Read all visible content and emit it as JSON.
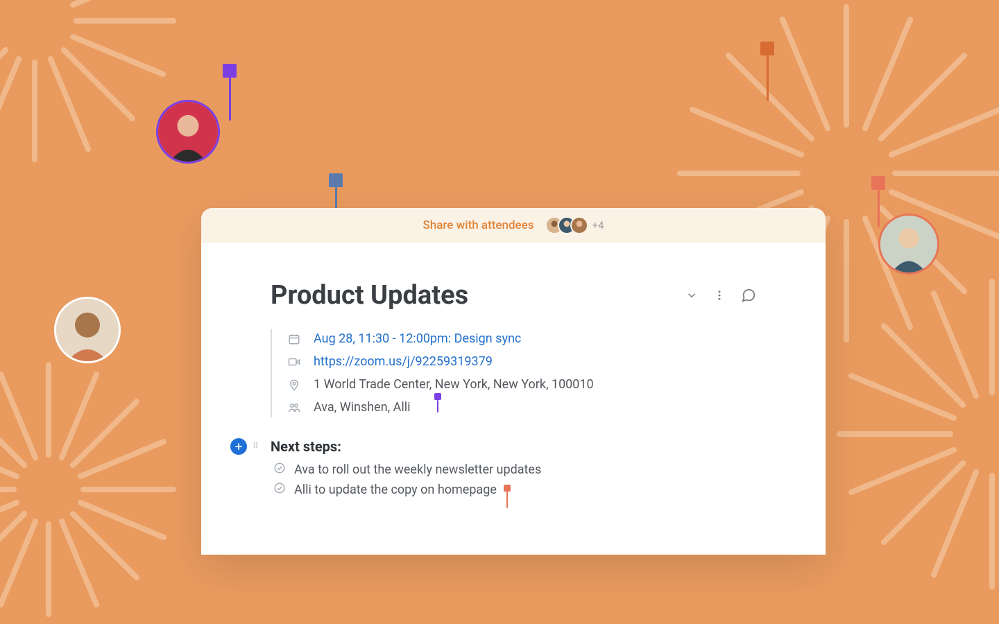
{
  "shareBar": {
    "label": "Share with attendees",
    "moreCount": "+4"
  },
  "doc": {
    "title": "Product Updates"
  },
  "meta": {
    "dateLine": "Aug 28, 11:30 - 12:00pm: Design sync",
    "link": "https://zoom.us/j/92259319379",
    "location": "1 World Trade Center, New York, New York, 100010",
    "people": "Ava, Winshen, Alli"
  },
  "nextSteps": {
    "title": "Next steps:",
    "items": [
      "Ava to roll out the weekly newsletter updates",
      "Alli to update the copy on homepage"
    ]
  },
  "colors": {
    "pinPurple": "#7B3FE4",
    "pinBlue": "#5C7AAE",
    "pinOrange": "#D86B32",
    "pinCoral": "#E77457"
  }
}
